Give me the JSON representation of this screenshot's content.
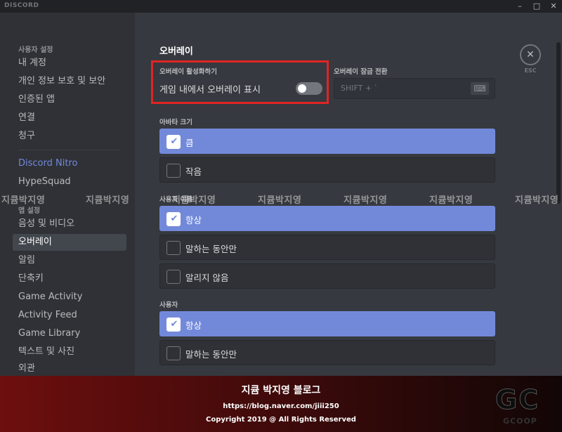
{
  "titlebar": {
    "brand": "DISCORD",
    "minimize": "–",
    "maximize": "□",
    "close": "✕"
  },
  "sidebar": {
    "user_settings_header": "사용자 설정",
    "user_items": [
      "내 계정",
      "개인 정보 보호 및 보안",
      "인증된 앱",
      "연결",
      "청구"
    ],
    "nitro": "Discord Nitro",
    "hypesquad": "HypeSquad",
    "app_settings_header": "앱 설정",
    "app_items": [
      "음성 및 비디오",
      "오버레이",
      "알림",
      "단축키",
      "Game Activity",
      "Activity Feed",
      "Game Library",
      "텍스트 및 사진",
      "외관"
    ],
    "selected": "오버레이"
  },
  "overlay": {
    "title": "오버레이",
    "enable_header": "오버레이 활성화하기",
    "toggle_label": "게임 내에서 오버레이 표시",
    "toggle_on": false,
    "lock_header": "오버레이 잠금 전환",
    "lock_value": "SHIFT + `",
    "keyboard_icon": "keyboard-icon",
    "avatar_size_header": "아바타 크기",
    "avatar_size_options": [
      {
        "label": "큼",
        "checked": true
      },
      {
        "label": "작음",
        "checked": false
      }
    ],
    "display_name_header": "사용자 이름",
    "display_name_options": [
      {
        "label": "항상",
        "checked": true
      },
      {
        "label": "말하는 동안만",
        "checked": false
      },
      {
        "label": "알리지 않음",
        "checked": false
      }
    ],
    "users_header": "사용자",
    "users_options": [
      {
        "label": "항상",
        "checked": true
      },
      {
        "label": "말하는 동안만",
        "checked": false
      }
    ],
    "close_label": "ESC",
    "check_glyph": "✔",
    "close_glyph": "✕",
    "keyboard_glyph": "⌨"
  },
  "watermark": "지큠박지영",
  "banner": {
    "title": "지큠 박지영 블로그",
    "url": "https://blog.naver.com/jiii250",
    "copyright": "Copyright 2019 @ All Rights Reserved",
    "logo": "GC",
    "logo_sub": "GCOOP"
  },
  "colors": {
    "accent": "#7289da",
    "highlight_box": "#e02424",
    "background": "#36393f",
    "sidebar": "#2f3136"
  }
}
